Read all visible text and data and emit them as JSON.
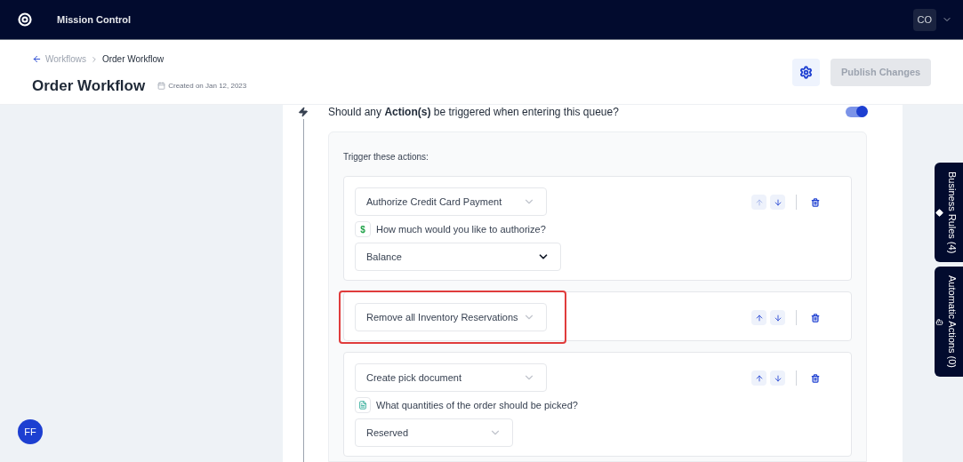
{
  "topbar": {
    "title": "Mission Control",
    "user": "CO"
  },
  "breadcrumb": [
    {
      "label": "Workflows",
      "current": false
    },
    {
      "label": "Order Workflow",
      "current": true
    }
  ],
  "page": {
    "title": "Order Workflow",
    "created": "Created on Jan 12, 2023",
    "publish": "Publish Changes",
    "publish_disabled": true
  },
  "trigger": {
    "question_before": "Should any ",
    "question_bold": "Action(s)",
    "question_after": " be triggered when entering this queue?",
    "on": true,
    "heading": "Trigger these actions:",
    "actions": [
      {
        "name": "Authorize Credit Card Payment",
        "highlighted": false,
        "up_disabled": true,
        "question": {
          "badge": "$",
          "text": "How much would you like to authorize?",
          "answer": "Balance"
        }
      },
      {
        "name": "Remove all Inventory Reservations",
        "highlighted": true,
        "up_disabled": false
      },
      {
        "name": "Create pick document",
        "highlighted": false,
        "up_disabled": false,
        "question": {
          "kind": "document",
          "text": "What quantities of the order should be picked?",
          "answer": "Reserved"
        }
      }
    ]
  },
  "side_tabs": [
    {
      "label": "Business Rules (4)",
      "kind": "rules"
    },
    {
      "label": "Automatic Actions (0)",
      "kind": "automation"
    }
  ],
  "user_avatar": "FF"
}
